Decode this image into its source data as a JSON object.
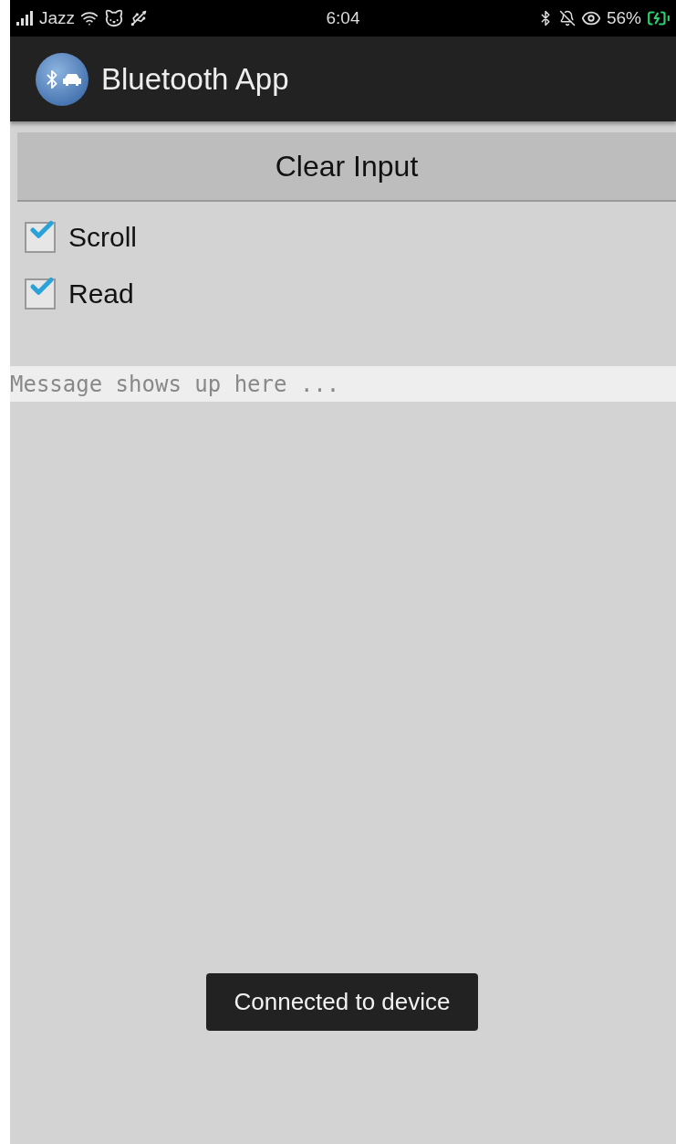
{
  "status_bar": {
    "carrier": "Jazz",
    "time": "6:04",
    "battery": "56%"
  },
  "app_bar": {
    "title": "Bluetooth App"
  },
  "clear_button": {
    "label": "Clear Input"
  },
  "checkboxes": [
    {
      "label": "Scroll",
      "checked": true
    },
    {
      "label": "Read",
      "checked": true
    }
  ],
  "message_field": {
    "placeholder": "Message shows up here ..."
  },
  "toast": {
    "text": "Connected to device"
  }
}
